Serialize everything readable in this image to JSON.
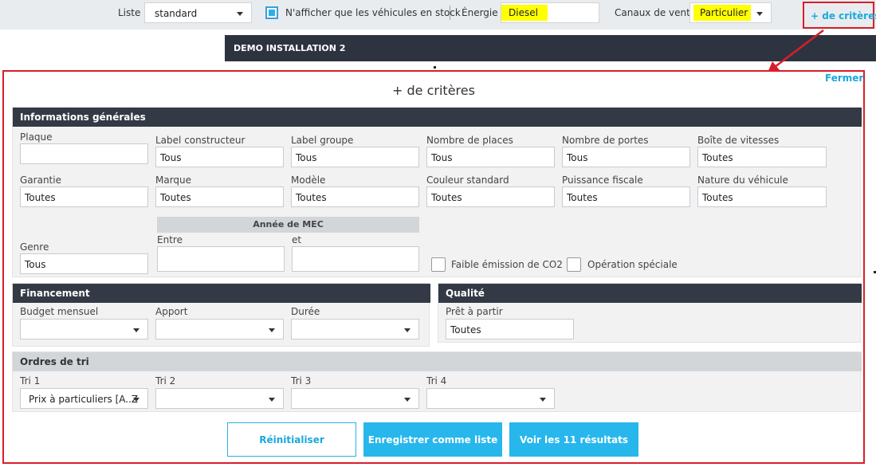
{
  "topbar": {
    "liste_label": "Liste",
    "liste_value": "standard",
    "stock_label": "N'afficher que les véhicules en stock",
    "energie_label": "Énergie",
    "energie_value": "Diesel",
    "canaux_label": "Canaux de vente",
    "canaux_value": "Particulier",
    "plus_criteres": "+ de critères"
  },
  "demo_bar": {
    "title": "DEMO INSTALLATION 2"
  },
  "panel": {
    "title": "+ de critères",
    "close_label": "Fermer",
    "general": {
      "heading": "Informations générales",
      "plaque_label": "Plaque",
      "plaque_value": "",
      "label_constructeur_label": "Label constructeur",
      "label_constructeur_value": "Tous",
      "label_groupe_label": "Label groupe",
      "label_groupe_value": "Tous",
      "nb_places_label": "Nombre de places",
      "nb_places_value": "Tous",
      "nb_portes_label": "Nombre de portes",
      "nb_portes_value": "Tous",
      "boite_label": "Boîte de vitesses",
      "boite_value": "Toutes",
      "garantie_label": "Garantie",
      "garantie_value": "Toutes",
      "marque_label": "Marque",
      "marque_value": "Toutes",
      "modele_label": "Modèle",
      "modele_value": "Toutes",
      "couleur_label": "Couleur standard",
      "couleur_value": "Toutes",
      "puissance_label": "Puissance fiscale",
      "puissance_value": "Toutes",
      "nature_label": "Nature du véhicule",
      "nature_value": "Toutes",
      "annee_mec_heading": "Année de MEC",
      "entre_label": "Entre",
      "et_label": "et",
      "genre_label": "Genre",
      "genre_value": "Tous",
      "faible_emission_label": "Faible émission de CO2",
      "operation_speciale_label": "Opération spéciale"
    },
    "financement": {
      "heading": "Financement",
      "budget_label": "Budget mensuel",
      "apport_label": "Apport",
      "duree_label": "Durée"
    },
    "qualite": {
      "heading": "Qualité",
      "pret_label": "Prêt à partir",
      "pret_value": "Toutes"
    },
    "tri": {
      "heading": "Ordres de tri",
      "tri1_label": "Tri 1",
      "tri1_value": "Prix à particuliers [A..Z",
      "tri2_label": "Tri 2",
      "tri3_label": "Tri 3",
      "tri4_label": "Tri 4"
    },
    "buttons": {
      "reset": "Réinitialiser",
      "save_list": "Enregistrer comme liste",
      "view_results": "Voir les 11 résultats"
    }
  },
  "colors": {
    "accent": "#1aa8dc",
    "highlight": "#ffff00",
    "annotation_red": "#d81e2a",
    "dark_header": "#333a46"
  }
}
